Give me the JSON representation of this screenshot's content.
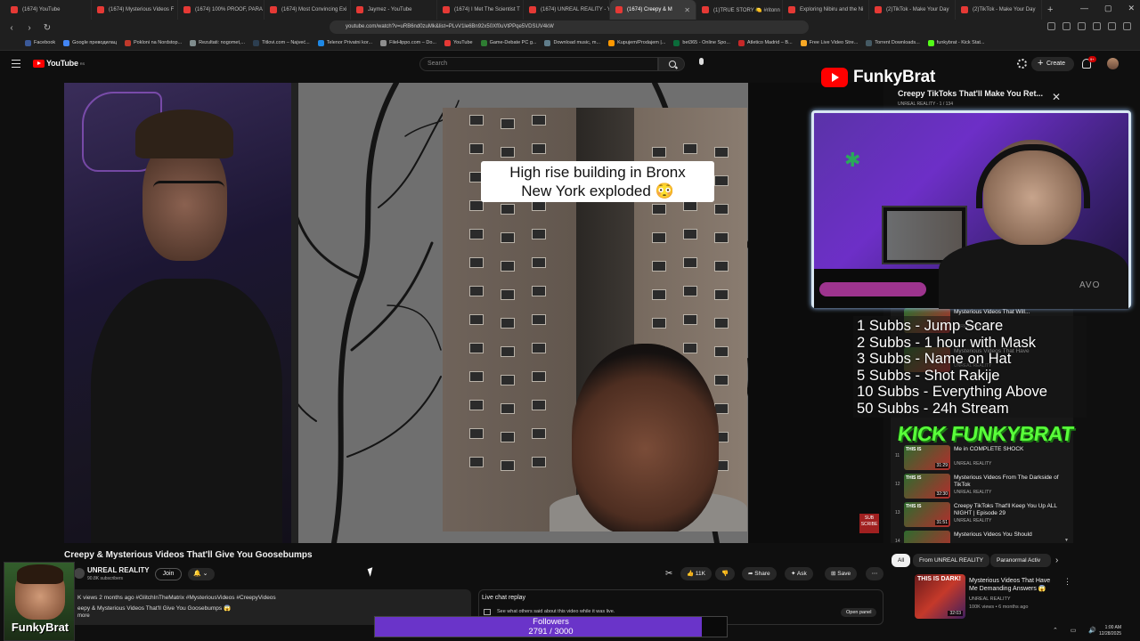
{
  "browser": {
    "tabs": [
      {
        "label": "(1674) YouTube",
        "active": false
      },
      {
        "label": "(1674) Mysterious Videos F",
        "active": false
      },
      {
        "label": "(1674) 100% PROOF, PARA",
        "active": false
      },
      {
        "label": "(1674) Most Convincing Exi",
        "active": false
      },
      {
        "label": "Jaymez - YouTube",
        "active": false
      },
      {
        "label": "(1674) I Met The Scientist T",
        "active": false
      },
      {
        "label": "(1674) UNREAL REALITY - Y",
        "active": false
      },
      {
        "label": "(1674) Creepy & M",
        "active": true
      },
      {
        "label": "(1)TRUE STORY 🍋 #ritonn",
        "active": false
      },
      {
        "label": "Exploring Nibiru and the Ni",
        "active": false
      },
      {
        "label": "(2)TikTok - Make Your Day",
        "active": false
      },
      {
        "label": "(2)TikTok - Make Your Day",
        "active": false
      }
    ],
    "url": "youtube.com/watch?v=uRB6nd0zuMk&list=PLvV1le6Bn92x50Xf0uVtPPqe5VDSUV4kW",
    "bookmarks": [
      {
        "label": "Facebook",
        "color": "#3b5998"
      },
      {
        "label": "Google преводилац",
        "color": "#4285f4"
      },
      {
        "label": "Pokloni na Nordstop...",
        "color": "#c0392b"
      },
      {
        "label": "Rezultati: nogomet,...",
        "color": "#7f8c8d"
      },
      {
        "label": "Titlovi.com – Najveć...",
        "color": "#2c3e50"
      },
      {
        "label": "Telenor Privatni kor...",
        "color": "#1e88e5"
      },
      {
        "label": "FileHippo.com – Do...",
        "color": "#8e8e8e"
      },
      {
        "label": "YouTube",
        "color": "#e53935"
      },
      {
        "label": "Game-Debate PC g...",
        "color": "#2e7d32"
      },
      {
        "label": "Download music, m...",
        "color": "#607d8b"
      },
      {
        "label": "Kupujem/Prodajem |...",
        "color": "#ff9800"
      },
      {
        "label": "bet365 - Online Spo...",
        "color": "#0b6b3a"
      },
      {
        "label": "Atletico Madrid – B...",
        "color": "#c62828"
      },
      {
        "label": "Free Live Video Stre...",
        "color": "#f9a825"
      },
      {
        "label": "Torrent Downloads...",
        "color": "#455a64"
      },
      {
        "label": "funkybrat - Kick Stat...",
        "color": "#53fc18"
      }
    ]
  },
  "youtube": {
    "logo": "YouTube",
    "region": "RS",
    "search_placeholder": "Search",
    "create_label": "Create",
    "notif_count": "9+"
  },
  "overlay": {
    "brand": "FunkyBrat",
    "kick_text": "KICK FUNKYBRAT",
    "card_name": "FunkyBrat",
    "webcam_brand": "AVO",
    "rewards": [
      "1 Subbs - Jump Scare",
      "2 Subbs - 1 hour with Mask",
      "3 Subbs - Name on Hat",
      "5 Subbs - Shot Rakije",
      "10 Subbs - Everything Above",
      "50 Subbs - 24h Stream"
    ],
    "followers_label": "Followers",
    "followers_count": "2791 / 3000",
    "followers_progress": 0.93
  },
  "player": {
    "caption": "High rise building in Bronx\nNew York exploded 😳",
    "badge": "SUB SCRIBE"
  },
  "playlist": {
    "title": "Creepy TikToks That'll Make You Ret...",
    "subtitle": "UNREAL REALITY - 1 / 134",
    "items": [
      {
        "idx": "",
        "title": "Mysterious Videos That Will...",
        "channel": "UNREAL REALITY",
        "dur": "",
        "label": ""
      },
      {
        "idx": "",
        "title": "Mysterious Videos That Have",
        "channel": "UNREAL REALITY",
        "dur": "",
        "label": ""
      },
      {
        "idx": "11",
        "title": "Me in COMPLETE SHOCK",
        "channel": "UNREAL REALITY",
        "dur": "31:29",
        "label": "THIS IS"
      },
      {
        "idx": "12",
        "title": "Mysterious Videos From The Darkside of TikTok",
        "channel": "UNREAL REALITY",
        "dur": "32:30",
        "label": "THIS IS"
      },
      {
        "idx": "13",
        "title": "Creepy TikToks That'll Keep You Up ALL NIGHT | Episode 29",
        "channel": "UNREAL REALITY",
        "dur": "31:51",
        "label": "THIS IS"
      },
      {
        "idx": "14",
        "title": "Mysterious Videos You Should",
        "channel": "",
        "dur": "",
        "label": ""
      }
    ]
  },
  "video": {
    "title": "Creepy & Mysterious Videos That'll Give You Goosebumps",
    "channel": "UNREAL REALITY",
    "subscribers": "90.8K subscribers",
    "join_label": "Join",
    "likes": "11K",
    "share_label": "Share",
    "ask_label": "Ask",
    "save_label": "Save",
    "desc_meta": "K views  2 months ago  #GlitchInTheMatrix #MysteriousVideos #CreepyVideos",
    "desc_text": "eepy & Mysterious Videos That'll Give You Goosebumps 😱",
    "desc_more": "more"
  },
  "chat": {
    "title": "Live chat replay",
    "subtitle": "See what others said about this video while it was live.",
    "open_label": "Open panel"
  },
  "filters": [
    {
      "label": "All",
      "selected": true
    },
    {
      "label": "From UNREAL REALITY",
      "selected": false
    },
    {
      "label": "Paranormal Activ",
      "selected": false
    }
  ],
  "side_video": {
    "title": "Mysterious Videos That Have Me Demanding Answers 😱",
    "channel": "UNREAL REALITY",
    "meta": "100K views • 6 months ago",
    "duration": "32:03",
    "label": "THIS IS DARK!"
  },
  "system": {
    "time": "1:00 AM",
    "date": "12/28/2025"
  }
}
